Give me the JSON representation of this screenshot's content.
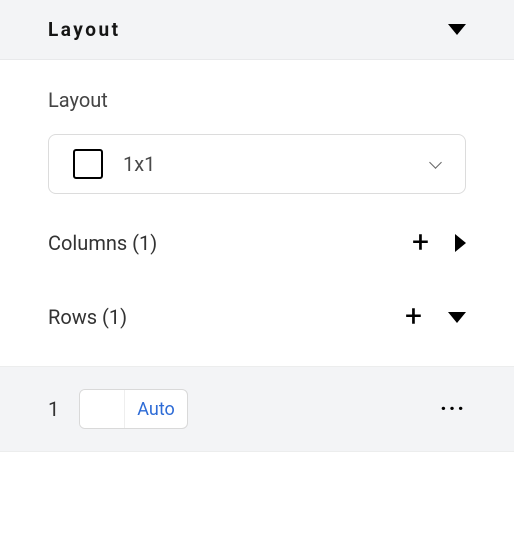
{
  "header": {
    "title": "Layout"
  },
  "layout": {
    "label": "Layout",
    "selected": "1x1"
  },
  "columns": {
    "label": "Columns (1)"
  },
  "rows": {
    "label": "Rows (1)"
  },
  "rowDetail": {
    "index": "1",
    "mode": "Auto"
  }
}
